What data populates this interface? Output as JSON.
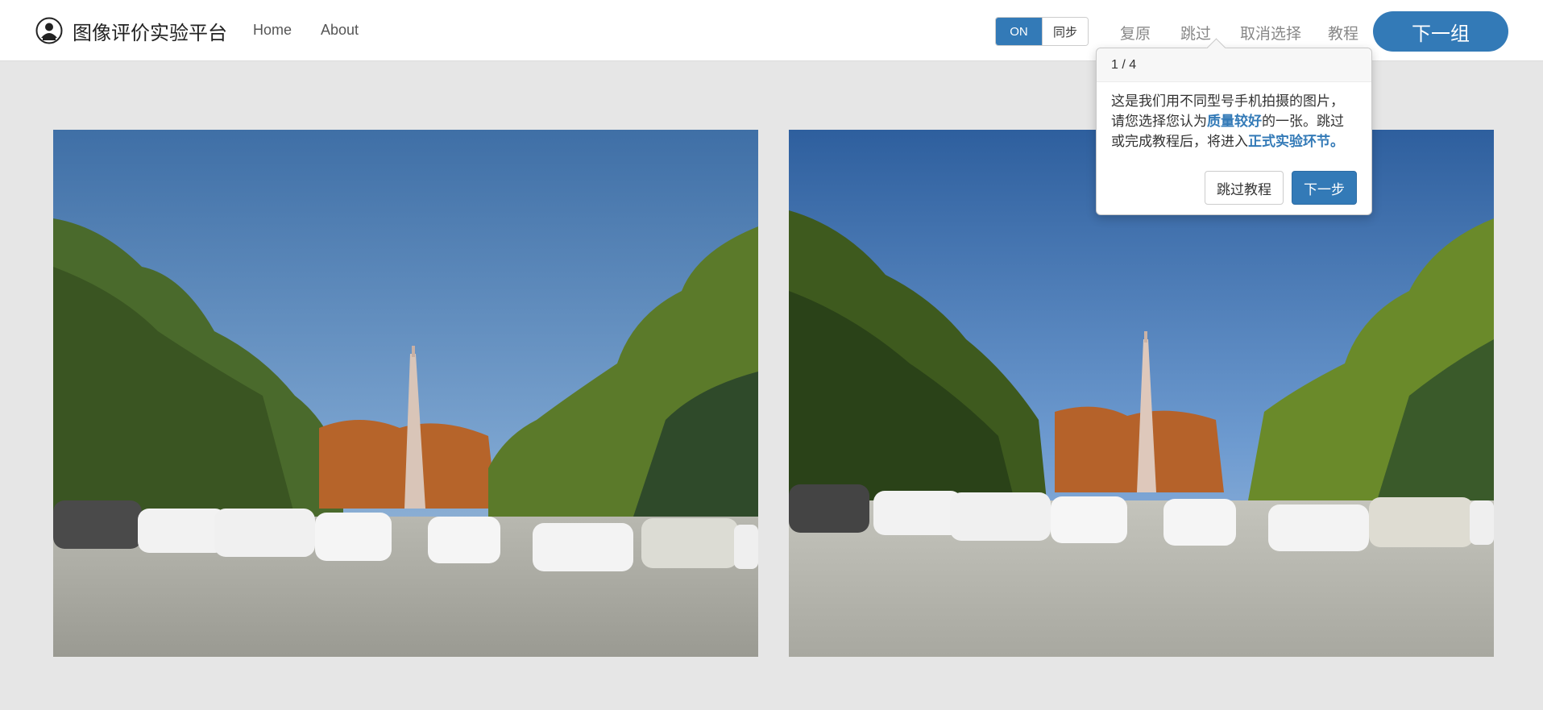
{
  "app": {
    "title": "图像评价实验平台"
  },
  "nav": {
    "home": "Home",
    "about": "About"
  },
  "toolbar": {
    "toggle_on": "ON",
    "toggle_sync": "同步",
    "restore": "复原",
    "skip": "跳过",
    "deselect": "取消选择",
    "tutorial": "教程",
    "next_group": "下一组"
  },
  "tour": {
    "step": "1 / 4",
    "text_part1": "这是我们用不同型号手机拍摄的图片，请您选择您认为",
    "highlight1": "质量较好",
    "text_part2": "的一张。跳过或完成教程后，将进入",
    "highlight2": "正式实验环节。",
    "skip_button": "跳过教程",
    "next_button": "下一步"
  },
  "colors": {
    "accent": "#337ab7",
    "page_bg": "#e6e6e6"
  },
  "icons": {
    "logo": "person-circle-icon"
  },
  "images": [
    {
      "name": "left-photo",
      "description_visible": false
    },
    {
      "name": "right-photo",
      "description_visible": false
    }
  ]
}
